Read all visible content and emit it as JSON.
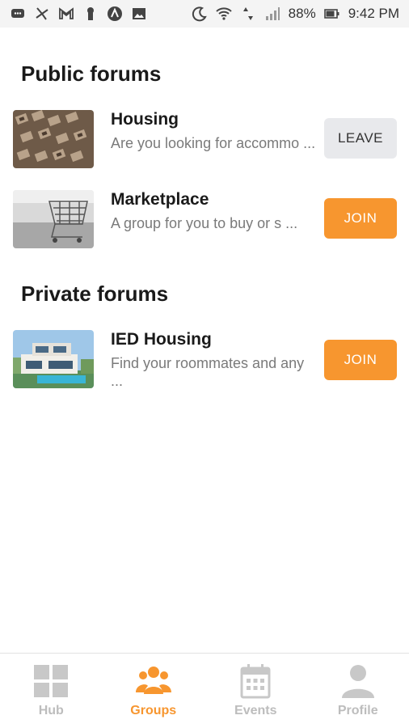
{
  "status_bar": {
    "battery": "88%",
    "time": "9:42 PM"
  },
  "public_forums": {
    "title": "Public forums",
    "items": [
      {
        "name": "Housing",
        "description": "Are you looking for accommo ...",
        "action": "LEAVE"
      },
      {
        "name": "Marketplace",
        "description": "A group for you to buy or s ...",
        "action": "JOIN"
      }
    ]
  },
  "private_forums": {
    "title": "Private forums",
    "items": [
      {
        "name": "IED Housing",
        "description": "Find your roommates and any ...",
        "action": "JOIN"
      }
    ]
  },
  "bottom_nav": {
    "items": [
      {
        "label": "Hub",
        "icon": "grid-icon"
      },
      {
        "label": "Groups",
        "icon": "group-icon"
      },
      {
        "label": "Events",
        "icon": "calendar-icon"
      },
      {
        "label": "Profile",
        "icon": "user-icon"
      }
    ],
    "active": "Groups"
  },
  "colors": {
    "accent": "#f7962f",
    "leave_button": "#e8e9ec",
    "inactive_nav": "#bdbdbd"
  }
}
